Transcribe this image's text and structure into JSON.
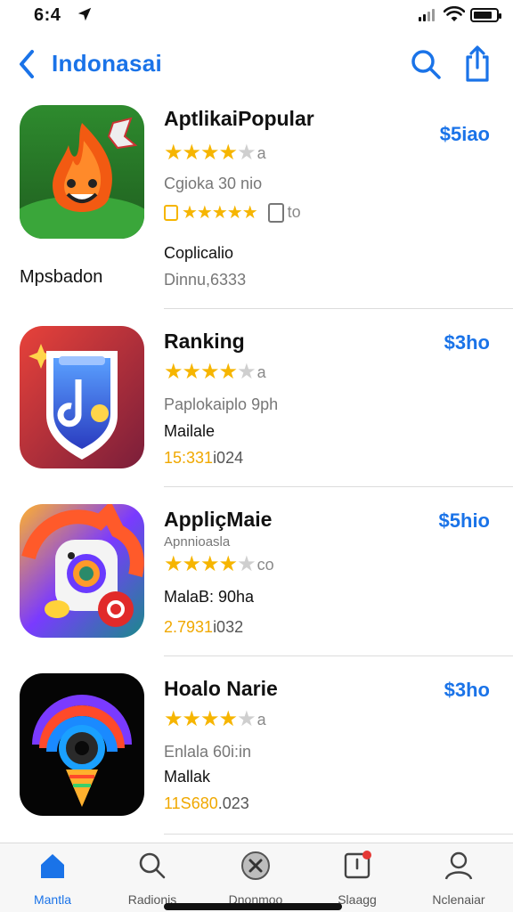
{
  "status_bar": {
    "time": "6:4"
  },
  "navbar": {
    "title": "Indonasai",
    "colors": {
      "accent": "#1a73e8"
    }
  },
  "side_label": "Mpsbadon",
  "apps": [
    {
      "name": "AptlikaiPopular",
      "price": "$5iao",
      "rating_count": "a",
      "line1": "Cgioka 30 nio",
      "stars_badge_text": "to",
      "line2": "Coplicalio",
      "line3": "Dinnu,6333",
      "icon": "fire-mascot-icon",
      "stars_full": 4
    },
    {
      "name": "Ranking",
      "price": "$3ho",
      "rating_count": "a",
      "line1": "Paplokaiplo 9ph",
      "line2": "Mailale",
      "line3_gold": "15:331",
      "line3_rest": "i024",
      "icon": "music-shield-icon",
      "stars_full": 4
    },
    {
      "name": "AppliçMaie",
      "price": "$5hio",
      "sub": "Apnnioasla",
      "rating_count": "co",
      "line1": "MalaB: 90ha",
      "line3_gold": "2.7931",
      "line3_rest": "i032",
      "icon": "camera-character-icon",
      "stars_full": 4
    },
    {
      "name": "Hoalo Narie",
      "price": "$3ho",
      "rating_count": "a",
      "line1": "Enlala 60i:in",
      "line2": "Mallak",
      "line3_gold": "11S680",
      "line3_rest": ".023",
      "icon": "rainbow-cone-icon",
      "stars_full": 4
    }
  ],
  "tabs": [
    {
      "label": "Mantla",
      "icon": "home-icon",
      "active": true
    },
    {
      "label": "Radionis",
      "icon": "search-icon",
      "active": false
    },
    {
      "label": "Dnonmoo",
      "icon": "close-circle-icon",
      "active": false
    },
    {
      "label": "Slaagg",
      "icon": "updates-icon",
      "active": false
    },
    {
      "label": "Nclenaiar",
      "icon": "profile-icon",
      "active": false
    }
  ]
}
